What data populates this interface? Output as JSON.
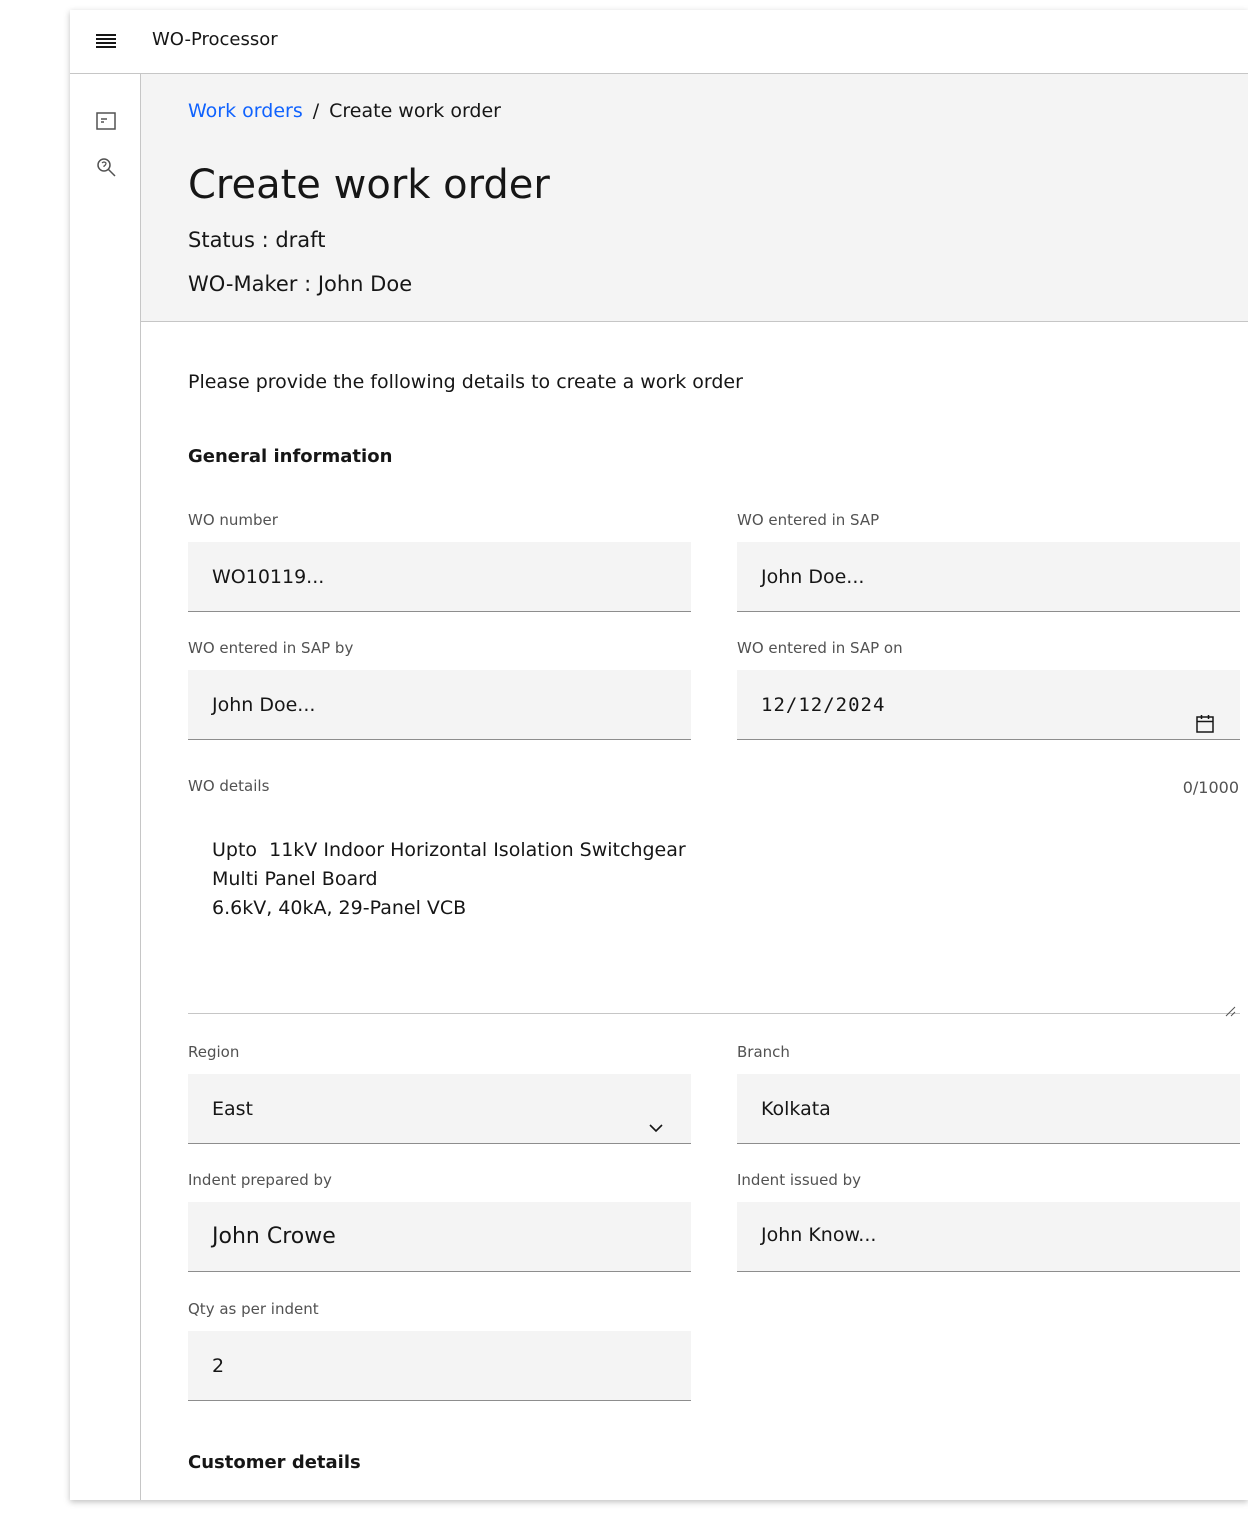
{
  "app": {
    "name": "WO-Processor"
  },
  "breadcrumb": {
    "parent": "Work orders",
    "separator": "/",
    "current": "Create work order"
  },
  "page": {
    "title": "Create work order",
    "status_line": "Status : draft",
    "maker_line": "WO-Maker : John Doe",
    "intro": "Please provide the following details to create a work order"
  },
  "sections": {
    "general": "General information",
    "customer": "Customer details"
  },
  "fields": {
    "wo_number": {
      "label": "WO number",
      "value": "WO10119..."
    },
    "wo_entered_sap": {
      "label": "WO entered in SAP",
      "value": "John Doe..."
    },
    "wo_entered_sap_by": {
      "label": "WO entered in SAP  by",
      "value": "John Doe..."
    },
    "wo_entered_sap_on": {
      "label": "WO entered in SAP  on",
      "value": "12/12/2024"
    },
    "wo_details": {
      "label": "WO details",
      "counter": "0/1000",
      "lines": [
        "Upto  11kV Indoor Horizontal Isolation Switchgear",
        "Multi Panel Board",
        "6.6kV, 40kA, 29-Panel VCB"
      ]
    },
    "region": {
      "label": "Region",
      "value": "East"
    },
    "branch": {
      "label": "Branch",
      "value": "Kolkata"
    },
    "indent_prepared_by": {
      "label": "Indent prepared by",
      "value": "John Crowe"
    },
    "indent_issued_by": {
      "label": "Indent issued by",
      "value": "John Know..."
    },
    "qty_as_per_indent": {
      "label": "Qty as per indent",
      "value": "2"
    }
  },
  "icons": {
    "menu": "hamburger-menu-icon",
    "nav_1": "form-document-icon",
    "nav_2": "search-history-icon",
    "calendar": "calendar-icon",
    "dropdown": "chevron-down-icon"
  }
}
